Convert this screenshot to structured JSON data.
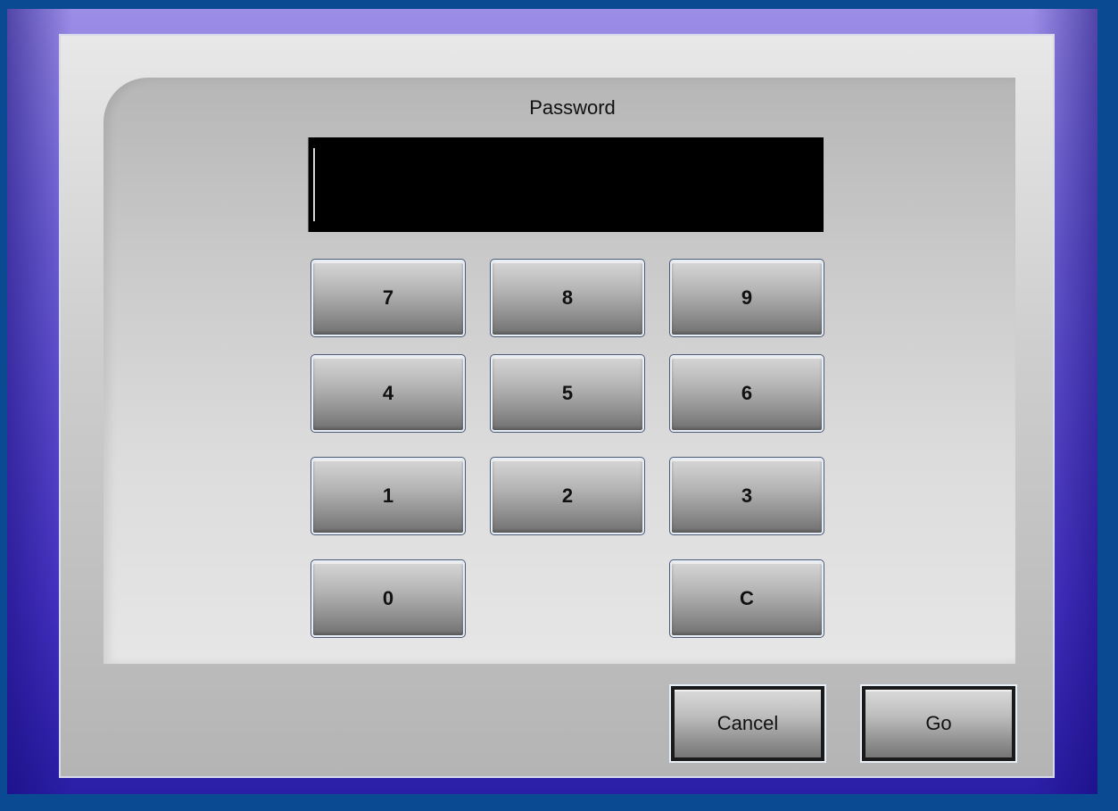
{
  "dialog": {
    "title": "Password",
    "password_value": ""
  },
  "keypad": {
    "k7": "7",
    "k8": "8",
    "k9": "9",
    "k4": "4",
    "k5": "5",
    "k6": "6",
    "k1": "1",
    "k2": "2",
    "k3": "3",
    "k0": "0",
    "clear": "C"
  },
  "actions": {
    "cancel": "Cancel",
    "go": "Go"
  },
  "colors": {
    "background": "#0a4a93",
    "bezel": "#5a46d0",
    "panel": "#cfcfcf",
    "display": "#000000"
  }
}
